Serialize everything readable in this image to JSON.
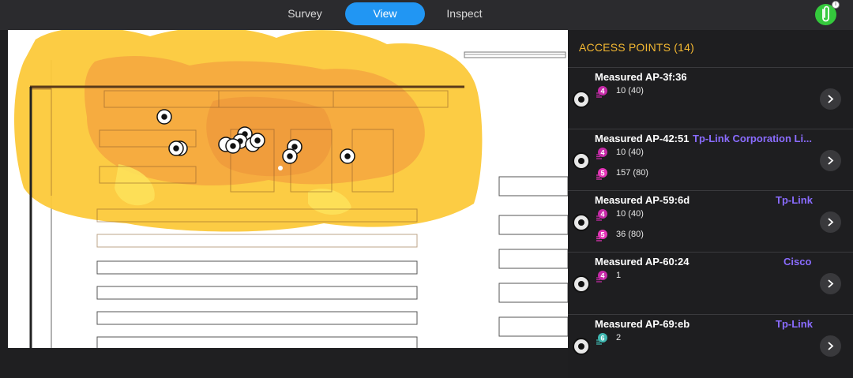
{
  "tabs": {
    "survey": "Survey",
    "view": "View",
    "inspect": "Inspect"
  },
  "avatar_badge": "i",
  "panel": {
    "title": "ACCESS POINTS (14)",
    "items": [
      {
        "name": "Measured AP-3f:36",
        "vendor": "",
        "bands": [
          {
            "band": "4",
            "color": "#c62aa8",
            "text": "10 (40)"
          }
        ]
      },
      {
        "name": "Measured AP-42:51",
        "vendor": "Tp-Link Corporation Li...",
        "bands": [
          {
            "band": "4",
            "color": "#c62aa8",
            "text": "10 (40)"
          },
          {
            "band": "5",
            "color": "#e535b8",
            "text": "157 (80)"
          }
        ]
      },
      {
        "name": "Measured AP-59:6d",
        "vendor": "Tp-Link",
        "bands": [
          {
            "band": "4",
            "color": "#c62aa8",
            "text": "10 (40)"
          },
          {
            "band": "5",
            "color": "#e535b8",
            "text": "36 (80)"
          }
        ]
      },
      {
        "name": "Measured AP-60:24",
        "vendor": "Cisco",
        "bands": [
          {
            "band": "4",
            "color": "#c62aa8",
            "text": "1"
          }
        ]
      },
      {
        "name": "Measured AP-69:eb",
        "vendor": "Tp-Link",
        "bands": [
          {
            "band": "6",
            "color": "#3fb7b0",
            "text": "2"
          }
        ]
      }
    ]
  },
  "colors": {
    "accent": "#2196f3",
    "title": "#f5b932",
    "vendor": "#8a6cff",
    "heatmap_outer": "#fcc93a",
    "heatmap_inner": "#f5a840"
  }
}
